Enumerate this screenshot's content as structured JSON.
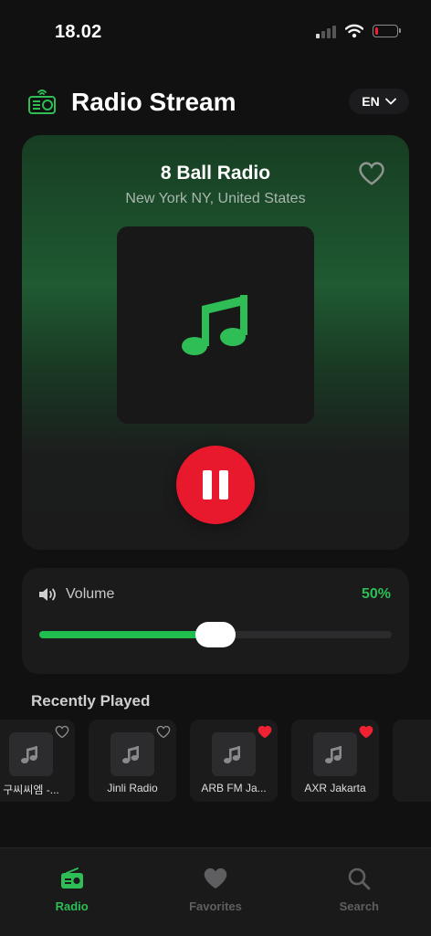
{
  "status_bar": {
    "time": "18.02",
    "signal_bars_active": 1,
    "battery_level": 0.1,
    "battery_color": "#ee2233"
  },
  "header": {
    "title": "Radio Stream",
    "language": "EN"
  },
  "player": {
    "station_name": "8 Ball Radio",
    "location": "New York NY, United States",
    "favorited": false,
    "state": "playing",
    "accent_color": "#1fbe4f",
    "pause_button_color": "#e8192d"
  },
  "volume": {
    "label": "Volume",
    "value_text": "50%",
    "level": 0.5
  },
  "recently_played": {
    "title": "Recently Played",
    "items": [
      {
        "name": "구씨씨엠 -...",
        "favorited": false
      },
      {
        "name": "Jinli Radio",
        "favorited": false
      },
      {
        "name": "ARB FM Ja...",
        "favorited": true
      },
      {
        "name": "AXR Jakarta",
        "favorited": true
      }
    ]
  },
  "tabs": [
    {
      "label": "Radio",
      "icon": "radio-icon",
      "active": true
    },
    {
      "label": "Favorites",
      "icon": "heart-icon",
      "active": false
    },
    {
      "label": "Search",
      "icon": "search-icon",
      "active": false
    }
  ]
}
